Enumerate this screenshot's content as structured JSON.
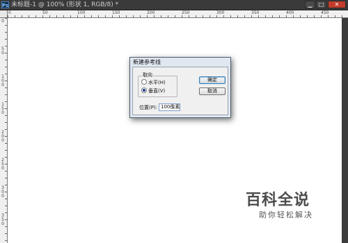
{
  "window": {
    "app_icon": "photoshop-icon",
    "title": "未标题-1 @ 100% (形状 1, RGB/8) *",
    "buttons": {
      "minimize": "▁",
      "maximize": "□",
      "close": "✕"
    }
  },
  "rulers": {
    "top": [
      "0",
      "50",
      "100",
      "150",
      "200",
      "250",
      "300",
      "350",
      "400",
      "450"
    ],
    "left": [
      "0",
      "50",
      "100",
      "150",
      "200",
      "250",
      "300",
      "350"
    ]
  },
  "dialog": {
    "title": "新建参考线",
    "orientation_group": {
      "legend": "取向",
      "options": [
        {
          "label": "水平(H)",
          "selected": false
        },
        {
          "label": "垂直(V)",
          "selected": true
        }
      ]
    },
    "ok_label": "确定",
    "cancel_label": "取消",
    "position_label": "位置(P):",
    "position_value": "100像素"
  },
  "watermark": {
    "title": "百科全说",
    "subtitle": "助你轻松解决"
  }
}
